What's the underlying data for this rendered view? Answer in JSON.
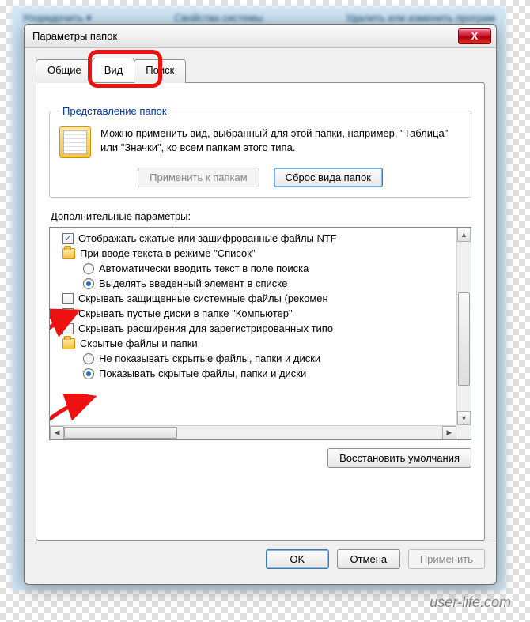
{
  "bg_menu": {
    "left": "Упорядочить ▾",
    "center": "Свойства системы",
    "right": "Удалить или изменить програм"
  },
  "dialog": {
    "title": "Параметры папок",
    "close_label": "X"
  },
  "tabs": {
    "general": "Общие",
    "view": "Вид",
    "search": "Поиск"
  },
  "folder_views": {
    "legend": "Представление папок",
    "description": "Можно применить вид, выбранный для этой папки, например, \"Таблица\" или \"Значки\", ко всем папкам этого типа.",
    "apply_btn": "Применить к папкам",
    "reset_btn": "Сброс вида папок"
  },
  "advanced": {
    "label": "Дополнительные параметры:",
    "items": [
      {
        "type": "checkbox",
        "checked": true,
        "level": 1,
        "text": "Отображать сжатые или зашифрованные файлы NTF"
      },
      {
        "type": "folder",
        "level": 1,
        "text": "При вводе текста в режиме \"Список\""
      },
      {
        "type": "radio",
        "checked": false,
        "level": 2,
        "text": "Автоматически вводить текст в поле поиска"
      },
      {
        "type": "radio",
        "checked": true,
        "level": 2,
        "text": "Выделять введенный элемент в списке"
      },
      {
        "type": "checkbox",
        "checked": false,
        "level": 1,
        "text": "Скрывать защищенные системные файлы (рекомен"
      },
      {
        "type": "checkbox",
        "checked": true,
        "level": 1,
        "text": "Скрывать пустые диски в папке \"Компьютер\""
      },
      {
        "type": "checkbox",
        "checked": false,
        "level": 1,
        "text": "Скрывать расширения для зарегистрированных типо"
      },
      {
        "type": "folder",
        "level": 1,
        "text": "Скрытые файлы и папки"
      },
      {
        "type": "radio",
        "checked": false,
        "level": 2,
        "text": "Не показывать скрытые файлы, папки и диски"
      },
      {
        "type": "radio",
        "checked": true,
        "level": 2,
        "text": "Показывать скрытые файлы, папки и диски"
      }
    ],
    "restore_btn": "Восстановить умолчания"
  },
  "footer": {
    "ok": "OK",
    "cancel": "Отмена",
    "apply": "Применить"
  },
  "watermark": "user-life.com"
}
